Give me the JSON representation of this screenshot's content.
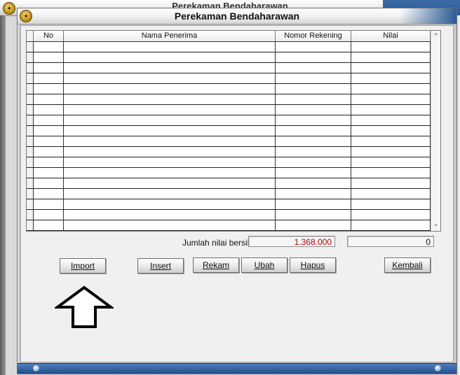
{
  "background_window": {
    "title": "Perekaman Bendaharawan"
  },
  "dialog": {
    "title": "Perekaman Bendaharawan"
  },
  "table": {
    "columns": [
      "No",
      "Nama Penerima",
      "Nomor Rekening",
      "Nilai"
    ],
    "row_count": 18
  },
  "totals": {
    "label": "Jumlah nilai bersih",
    "value_1": "1.368.000",
    "value_2": "0"
  },
  "buttons": {
    "import": "Import",
    "insert": "Insert",
    "rekam": "Rekam",
    "ubah": "Ubah",
    "hapus": "Hapus",
    "kembali": "Kembali"
  },
  "icons": {
    "app_logo": "emblem-icon",
    "annotation": "up-arrow-icon",
    "scroll_up": "chevron-up-icon",
    "scroll_down": "chevron-down-icon"
  },
  "colors": {
    "accent_value": "#b00000",
    "titlebar_blue": "#1f4f8a"
  }
}
